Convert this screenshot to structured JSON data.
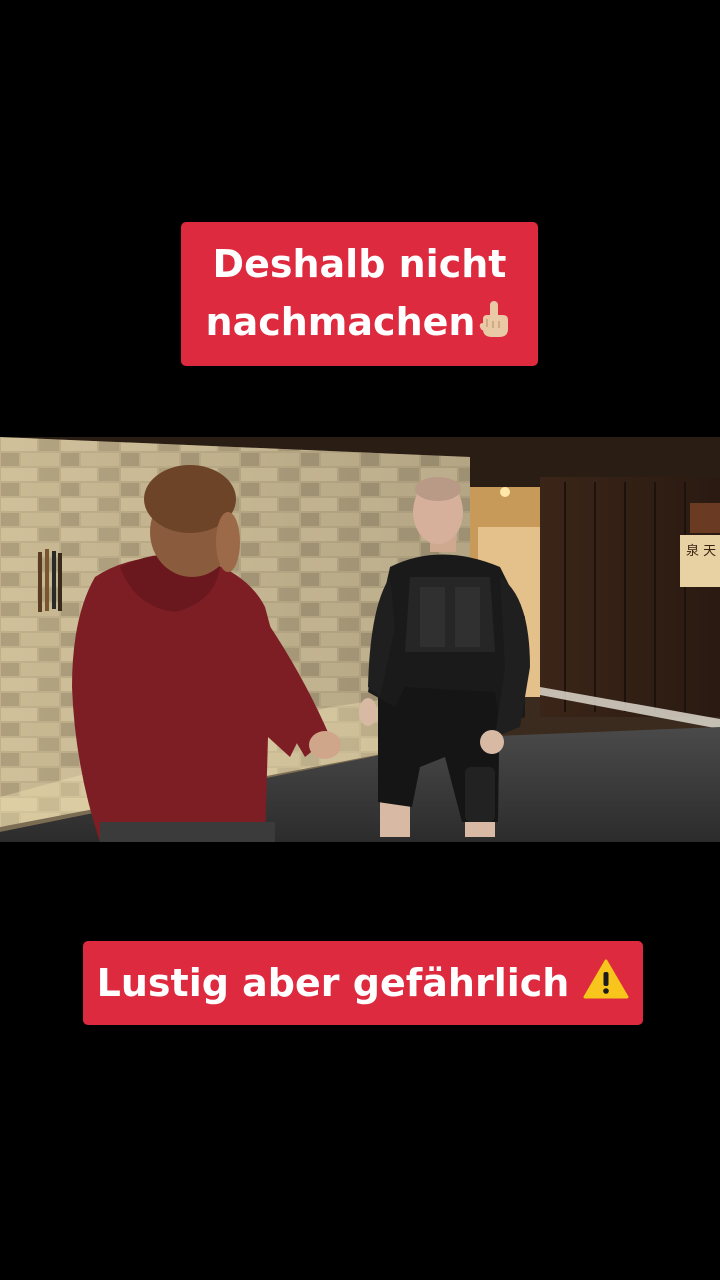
{
  "captions": {
    "top_line1": "Deshalb nicht",
    "top_line2": "nachmachen",
    "top_emoji_icon": "pointing-up-finger-icon",
    "bottom": "Lustig aber gefährlich",
    "bottom_emoji_icon": "warning-sign-icon",
    "background_color": "#dd2a3f",
    "text_color": "#ffffff"
  },
  "scene": {
    "wall_sign_text": "泉 天"
  }
}
